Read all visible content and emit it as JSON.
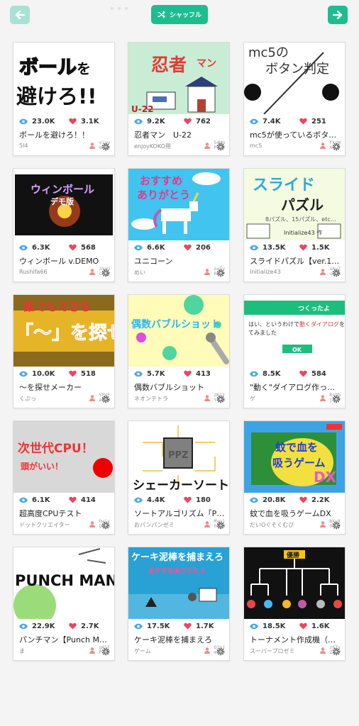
{
  "toolbar": {
    "shuffle_label": "シャッフル",
    "back_icon": "arrow-left-icon",
    "next_icon": "arrow-right-icon"
  },
  "colors": {
    "accent": "#1dbd8f",
    "accent_disabled": "#a8e2d5",
    "eye": "#47a7e8",
    "heart": "#e84761",
    "avatar": "#ef8a8a"
  },
  "cards": [
    {
      "views": "23.0K",
      "likes": "3.1K",
      "title": "ボールを避けろ！！",
      "author": "5l4",
      "uid1": "vixw",
      "uid2": "dPFx",
      "thumb_text": "ボールを 避けろ!!"
    },
    {
      "views": "9.2K",
      "likes": "762",
      "title": "忍者マン　U-22",
      "author": "enjoyKOKO用",
      "uid1": "54Wm",
      "uid2": "PVT2",
      "thumb_text": "忍者マン U-22"
    },
    {
      "views": "7.4K",
      "likes": "251",
      "title": "mc5が使っているボタン判定",
      "author": "mc5",
      "uid1": "FkrW",
      "uid2": "XGw7",
      "thumb_text": "mc5の ボタン判定"
    },
    {
      "views": "6.3K",
      "likes": "568",
      "title": "ウィンボール v.DEMO",
      "author": "Rushifa66",
      "uid1": "zmaU",
      "uid2": "cKqV",
      "thumb_text": "ウィンボール デモ版"
    },
    {
      "views": "6.6K",
      "likes": "206",
      "title": "ユニコーン",
      "author": "めい",
      "uid1": "oxFy",
      "uid2": "RQS-",
      "thumb_text": "おすすめ ありがとう"
    },
    {
      "views": "13.5K",
      "likes": "1.5K",
      "title": "スライドパズル【ver.1.2】",
      "author": "Initialize43",
      "uid1": "uAuZ",
      "uid2": "uw9A",
      "thumb_text": "スライド パズル 8パズル、15パズル、etc… Initialize43 作"
    },
    {
      "views": "10.0K",
      "likes": "518",
      "title": "〜を探せメーカー",
      "author": "くぷっ",
      "uid1": "YPVF",
      "uid2": "az8p",
      "thumb_text": "誰でもできる 「〜」を探せ"
    },
    {
      "views": "5.7K",
      "likes": "413",
      "title": "偶数バブルショット",
      "author": "ネオンテトラ",
      "uid1": "2KCz",
      "uid2": "Yo76",
      "thumb_text": "偶数バブルショット"
    },
    {
      "views": "8.5K",
      "likes": "584",
      "title": "\"動く\"ダイアログ作ったよ",
      "author": "ゲ",
      "uid1": "Rs9b",
      "uid2": "jX5P",
      "thumb_text": "つくったよ はい、というわけで動くダイアログを作ってみました OK"
    },
    {
      "views": "6.1K",
      "likes": "414",
      "title": "超高度CPUテスト",
      "author": "ドットクリエイター",
      "uid1": "hwiy",
      "uid2": "QQWR",
      "thumb_text": "次世代CPU！ 頭がいい！"
    },
    {
      "views": "4.4K",
      "likes": "180",
      "title": "ソートアルゴリズム「PPZ」",
      "author": "おパンパンゼミ",
      "uid1": "Myo1",
      "uid2": "hnRH",
      "thumb_text": "PPZ シェーカーソート"
    },
    {
      "views": "20.8K",
      "likes": "2.2K",
      "title": "蚊で血を吸うゲームDX",
      "author": "だいOぐそくむび",
      "uid1": "BXuX",
      "uid2": "9xWy",
      "thumb_text": "蚊で血を 吸うゲーム DX"
    },
    {
      "views": "22.9K",
      "likes": "2.7K",
      "title": "パンチマン【Punch Man】",
      "author": "ま",
      "uid1": "gA5F",
      "uid2": "P2bE",
      "thumb_text": "PUNCH MAN"
    },
    {
      "views": "17.5K",
      "likes": "1.7K",
      "title": "ケーキ泥棒を捕まえろ",
      "author": "ゲーム",
      "uid1": "Q2nz",
      "uid2": "mz8s",
      "thumb_text": "ケーキ泥棒を捕まえろ おすすめありがとう"
    },
    {
      "views": "18.5K",
      "likes": "1.6K",
      "title": "トーナメント作成機（β版）",
      "author": "スーパープロゼミ",
      "uid1": "z6Zy",
      "uid2": "Z37Y",
      "thumb_text": "優勝"
    }
  ]
}
